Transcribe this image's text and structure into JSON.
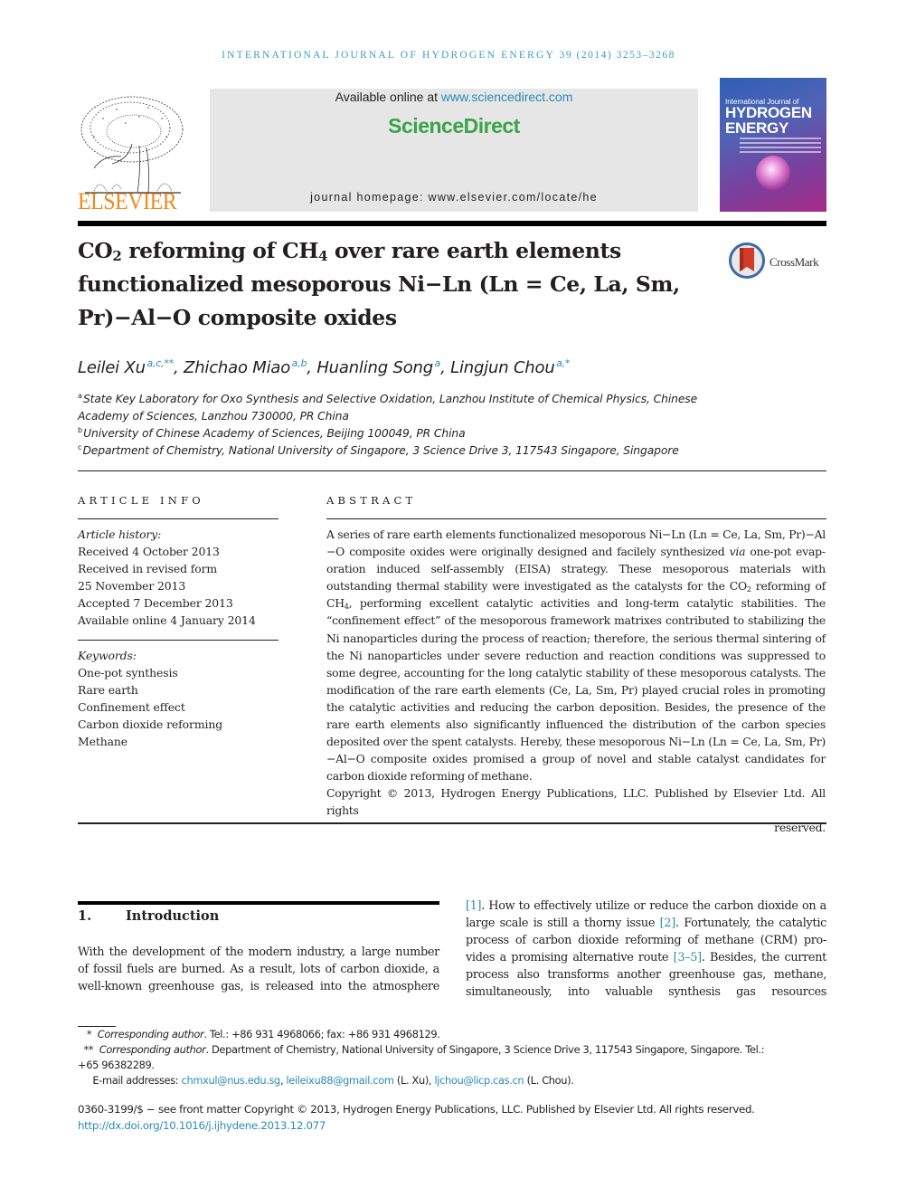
{
  "header": {
    "journal_name": "International Journal of Hydrogen Energy",
    "volume_pages": "39 (2014) 3253–3268"
  },
  "publisher": {
    "logo_icon": "elsevier-tree-icon",
    "name": "ELSEVIER"
  },
  "sciencedirect": {
    "available_prefix": "Available online at ",
    "available_link": "www.sciencedirect.com",
    "brand": "ScienceDirect",
    "homepage": "journal homepage: www.elsevier.com/locate/he"
  },
  "cover": {
    "small_title": "International Journal of",
    "big_title_1": "HYDROGEN",
    "big_title_2": "ENERGY"
  },
  "article": {
    "title_parts": {
      "p1": "CO",
      "sub1": "2",
      "p2": " reforming of CH",
      "sub2": "4",
      "p3": " over rare earth elements",
      "line2": "functionalized mesoporous Ni−Ln (Ln = Ce, La, Sm,",
      "line3": "Pr)−Al−O composite oxides"
    },
    "crossmark_label": "CrossMark",
    "authors": [
      {
        "name": "Leilei Xu",
        "sup": "a,c,**"
      },
      {
        "name": "Zhichao Miao",
        "sup": "a,b"
      },
      {
        "name": "Huanling Song",
        "sup": "a"
      },
      {
        "name": "Lingjun Chou",
        "sup": "a,*"
      }
    ],
    "affiliations": [
      {
        "key": "a",
        "line1": "State Key Laboratory for Oxo Synthesis and Selective Oxidation, Lanzhou Institute of Chemical Physics, Chinese",
        "line2": "Academy of Sciences, Lanzhou 730000, PR China"
      },
      {
        "key": "b",
        "line1": "University of Chinese Academy of Sciences, Beijing 100049, PR China"
      },
      {
        "key": "c",
        "line1": "Department of Chemistry, National University of Singapore, 3 Science Drive 3, 117543 Singapore, Singapore"
      }
    ]
  },
  "article_info": {
    "heading": "ARTICLE INFO",
    "history_label": "Article history:",
    "history": [
      "Received 4 October 2013",
      "Received in revised form",
      "25 November 2013",
      "Accepted 7 December 2013",
      "Available online 4 January 2014"
    ],
    "keywords_label": "Keywords:",
    "keywords": [
      "One-pot synthesis",
      "Rare earth",
      "Confinement effect",
      "Carbon dioxide reforming",
      "Methane"
    ]
  },
  "abstract": {
    "heading": "ABSTRACT",
    "t1": "A series of rare earth elements functionalized mesoporous Ni−Ln (Ln = Ce, La, Sm, Pr)−Al −O composite oxides were originally designed and facilely synthesized ",
    "via": "via",
    "t2": " one-pot evap­oration induced self-assembly (EISA) strategy. These mesoporous materials with outstanding thermal stability were investigated as the catalysts for the CO",
    "sub_a": "2",
    "t3": " reforming of CH",
    "sub_b": "4",
    "t4": ", performing excellent catalytic activities and long-term catalytic stabilities. The “confinement effect” of the mesoporous framework matrixes contributed to stabilizing the Ni nanoparticles during the process of reaction; therefore, the serious thermal sintering of the Ni nanoparticles under severe reduction and reaction conditions was suppressed to some degree, accounting for the long catalytic stability of these mesoporous catalysts. The modification of the rare earth elements (Ce, La, Sm, Pr) played crucial roles in promoting the catalytic activities and reducing the carbon deposition. Besides, the presence of the rare earth elements also significantly influenced the distribution of the carbon species depos­ited over the spent catalysts. Hereby, these mesoporous Ni−Ln (Ln = Ce, La, Sm, Pr)−Al−O composite oxides promised a group of novel and stable catalyst candidates for carbon dioxide reforming of methane.",
    "copyright_1": "Copyright © 2013, Hydrogen Energy Publications, LLC. Published by Elsevier Ltd. All rights",
    "copyright_2": "reserved."
  },
  "introduction": {
    "number": "1.",
    "heading": "Introduction",
    "left_lines": [
      "With the development of the modern industry, a large number",
      "of fossil fuels are burned. As a result, lots of carbon dioxide, a",
      "well-known greenhouse gas, is released into the atmosphere"
    ],
    "right": {
      "ref1": "[1]",
      "r1": ". How to effectively utilize or reduce the carbon dioxide on a",
      "r2": "large scale is still a thorny issue ",
      "ref2": "[2]",
      "r2b": ". Fortunately, the catalytic",
      "r3": "process of carbon dioxide reforming of methane (CRM) pro-",
      "r4": "vides a promising alternative route ",
      "ref3": "[3–5]",
      "r4b": ". Besides, the current",
      "r5": "process also transforms another greenhouse gas, methane,",
      "r6_words": [
        "simultaneously,",
        "into",
        "valuable",
        "synthesis",
        "gas",
        "resources"
      ]
    }
  },
  "footnotes": {
    "fn1_mark": "*",
    "fn1_label": "Corresponding author",
    "fn1_text": ". Tel.: +86 931 4968066; fax: +86 931 4968129.",
    "fn2_mark": "**",
    "fn2_label": "Corresponding author",
    "fn2_text": ". Department of Chemistry, National University of Singapore, 3 Science Drive 3, 117543 Singapore, Singapore. Tel.:",
    "fn2_cont": "+65 96382289.",
    "email_label": "E-mail addresses: ",
    "email1": "chmxul@nus.edu.sg",
    "email2": "leileixu88@gmail.com",
    "email2_who": " (L. Xu), ",
    "email3": "ljchou@licp.cas.cn",
    "email3_who": " (L. Chou)."
  },
  "front_matter": {
    "issn_line": "0360-3199/$ − see front matter Copyright © 2013, Hydrogen Energy Publications, LLC. Published by Elsevier Ltd. All rights reserved.",
    "doi": "http://dx.doi.org/10.1016/j.ijhydene.2013.12.077"
  },
  "colors": {
    "link": "#2a8bb8",
    "journal_header": "#3a9dc4",
    "elsevier_orange": "#f08a1d",
    "sciencedirect_green": "#3aa34a",
    "sd_box_bg": "#e6e6e6"
  }
}
